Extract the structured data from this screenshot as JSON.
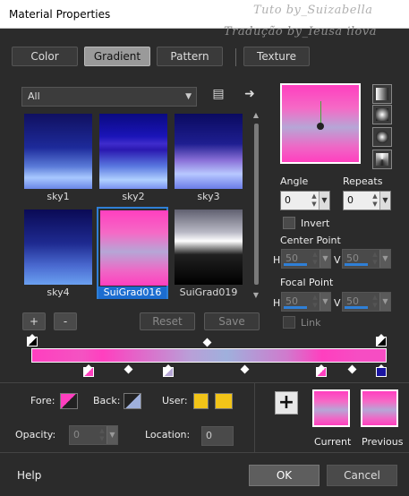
{
  "window": {
    "title": "Material Properties"
  },
  "watermark": {
    "line1": "Tuto by_Suizabella",
    "line2": "Tradução by_Ieusa ilova"
  },
  "tabs": [
    {
      "label": "Color",
      "active": false
    },
    {
      "label": "Gradient",
      "active": true
    },
    {
      "label": "Pattern",
      "active": false
    },
    {
      "label": "Texture",
      "active": false
    }
  ],
  "gallery": {
    "category": "All",
    "items": [
      {
        "label": "sky1"
      },
      {
        "label": "sky2"
      },
      {
        "label": "sky3"
      },
      {
        "label": "sky4"
      },
      {
        "label": "SuiGrad016",
        "selected": true
      },
      {
        "label": "SuiGrad019"
      }
    ],
    "add_label": "+",
    "remove_label": "-",
    "reset_label": "Reset",
    "save_label": "Save"
  },
  "settings": {
    "angle_label": "Angle",
    "angle_value": "0",
    "repeats_label": "Repeats",
    "repeats_value": "0",
    "invert_label": "Invert",
    "center_label": "Center Point",
    "center_h_label": "H",
    "center_h_value": "50",
    "center_v_label": "V",
    "center_v_value": "50",
    "focal_label": "Focal Point",
    "focal_h_label": "H",
    "focal_h_value": "50",
    "focal_v_label": "V",
    "focal_v_value": "50",
    "link_label": "Link"
  },
  "bottom": {
    "fore_label": "Fore:",
    "back_label": "Back:",
    "user_label": "User:",
    "opacity_label": "Opacity:",
    "opacity_value": "0",
    "location_label": "Location:",
    "location_value": "0",
    "current_label": "Current",
    "previous_label": "Previous",
    "add_symbol": "+"
  },
  "footer": {
    "help_label": "Help",
    "ok_label": "OK",
    "cancel_label": "Cancel"
  },
  "colors": {
    "accent": "#1c6dd0",
    "pink": "#ff3fbf",
    "lavender": "#9fb0dc",
    "user_yellow": "#f2c418"
  }
}
